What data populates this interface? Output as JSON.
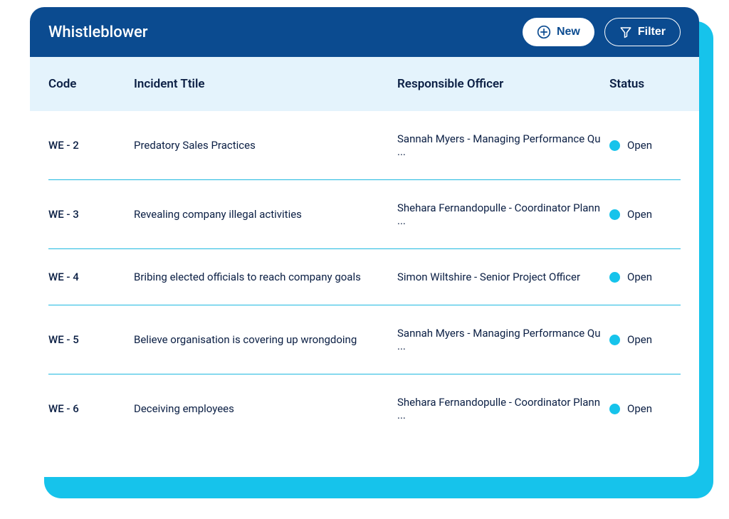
{
  "header": {
    "title": "Whistleblower",
    "new_label": "New",
    "filter_label": "Filter"
  },
  "columns": {
    "code": "Code",
    "title": "Incident Ttile",
    "officer": "Responsible Officer",
    "status": "Status"
  },
  "status_color": "#16c3eb",
  "rows": [
    {
      "code": "WE - 2",
      "title": "Predatory Sales Practices",
      "officer": "Sannah Myers - Managing Performance Qu ...",
      "status": "Open"
    },
    {
      "code": "WE - 3",
      "title": "Revealing company illegal activities",
      "officer": "Shehara Fernandopulle - Coordinator Plann ...",
      "status": "Open"
    },
    {
      "code": "WE - 4",
      "title": "Bribing elected officials to reach company goals",
      "officer": "Simon Wiltshire - Senior Project Officer",
      "status": "Open"
    },
    {
      "code": "WE - 5",
      "title": "Believe organisation is covering up wrongdoing",
      "officer": "Sannah Myers - Managing Performance Qu ...",
      "status": "Open"
    },
    {
      "code": "WE - 6",
      "title": "Deceiving employees",
      "officer": "Shehara Fernandopulle - Coordinator Plann ...",
      "status": "Open"
    }
  ]
}
